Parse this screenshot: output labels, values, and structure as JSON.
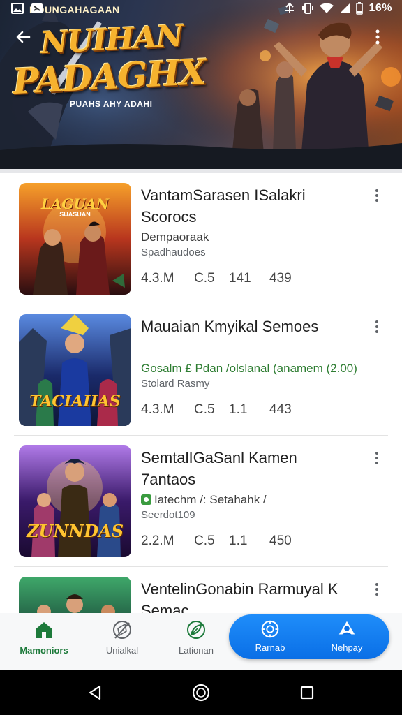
{
  "status_bar": {
    "battery_text": "16%",
    "icons": [
      "image-notification-icon",
      "app-notification-icon",
      "data-saver-icon",
      "vibrate-icon",
      "wifi-icon",
      "signal-icon",
      "battery-icon"
    ]
  },
  "hero": {
    "kicker": "HOUNGAHAGAAN",
    "title_line1": "NUIHAN",
    "title_line2": "PADAGHX",
    "tagline": "PUAHS AHY ADAHI",
    "back_icon": "back-arrow-icon",
    "menu_icon": "more-vert-icon"
  },
  "list": {
    "items": [
      {
        "title": "VantamSarasen ISalakri Scorocs",
        "sub1": "Dempaoraak",
        "sub2": "Spadhaudoes",
        "stats": [
          "4.3.M",
          "C.5",
          "141",
          "439"
        ],
        "thumb_title": "LAGUAN",
        "thumb_sub": "SUASUAN",
        "thumb_colors": [
          "#f6a02a",
          "#b8361e",
          "#2a0e10"
        ]
      },
      {
        "title": "Mauaian Kmyikal Semoes",
        "sub1": "Gosalm £ Pdan /olslanal (anamem (2.00)",
        "sub2": "Stolard Rasmy",
        "stats": [
          "4.3.M",
          "C.5",
          "1.1",
          "443"
        ],
        "thumb_title": "TACIAIIAS",
        "thumb_sub": "",
        "thumb_colors": [
          "#3a6fd0",
          "#1a2a6a",
          "#0e1636"
        ]
      },
      {
        "title": "SemtalIGaSanl Kamen 7antaos",
        "sub1": "Iatechm /: Setahahk /",
        "sub2": "Seerdot109",
        "stats": [
          "2.2.M",
          "C.5",
          "1.1",
          "450"
        ],
        "thumb_title": "ZUNNDAS",
        "thumb_sub": "",
        "thumb_colors": [
          "#8a4ad0",
          "#3a1a6a",
          "#1a0a30"
        ]
      },
      {
        "title": "VentelinGonabin Rarmuyal K Semac",
        "sub1": "",
        "sub2": "",
        "stats": [],
        "thumb_title": "",
        "thumb_sub": "",
        "thumb_colors": [
          "#2f8a5a",
          "#1a4a3a",
          "#0e2a20"
        ]
      }
    ]
  },
  "bottom_nav": {
    "tabs": [
      {
        "label": "Mamoniors",
        "icon": "home-icon",
        "active": true
      },
      {
        "label": "Unialkal",
        "icon": "compass-icon",
        "active": false
      },
      {
        "label": "Lationan",
        "icon": "leaf-icon",
        "active": false
      }
    ],
    "pill_tabs": [
      {
        "label": "Rarnab",
        "icon": "shield-icon"
      },
      {
        "label": "Nehpay",
        "icon": "person-icon"
      }
    ]
  },
  "system_nav": {
    "icons": [
      "back-triangle-icon",
      "home-circle-icon",
      "recents-square-icon"
    ]
  }
}
